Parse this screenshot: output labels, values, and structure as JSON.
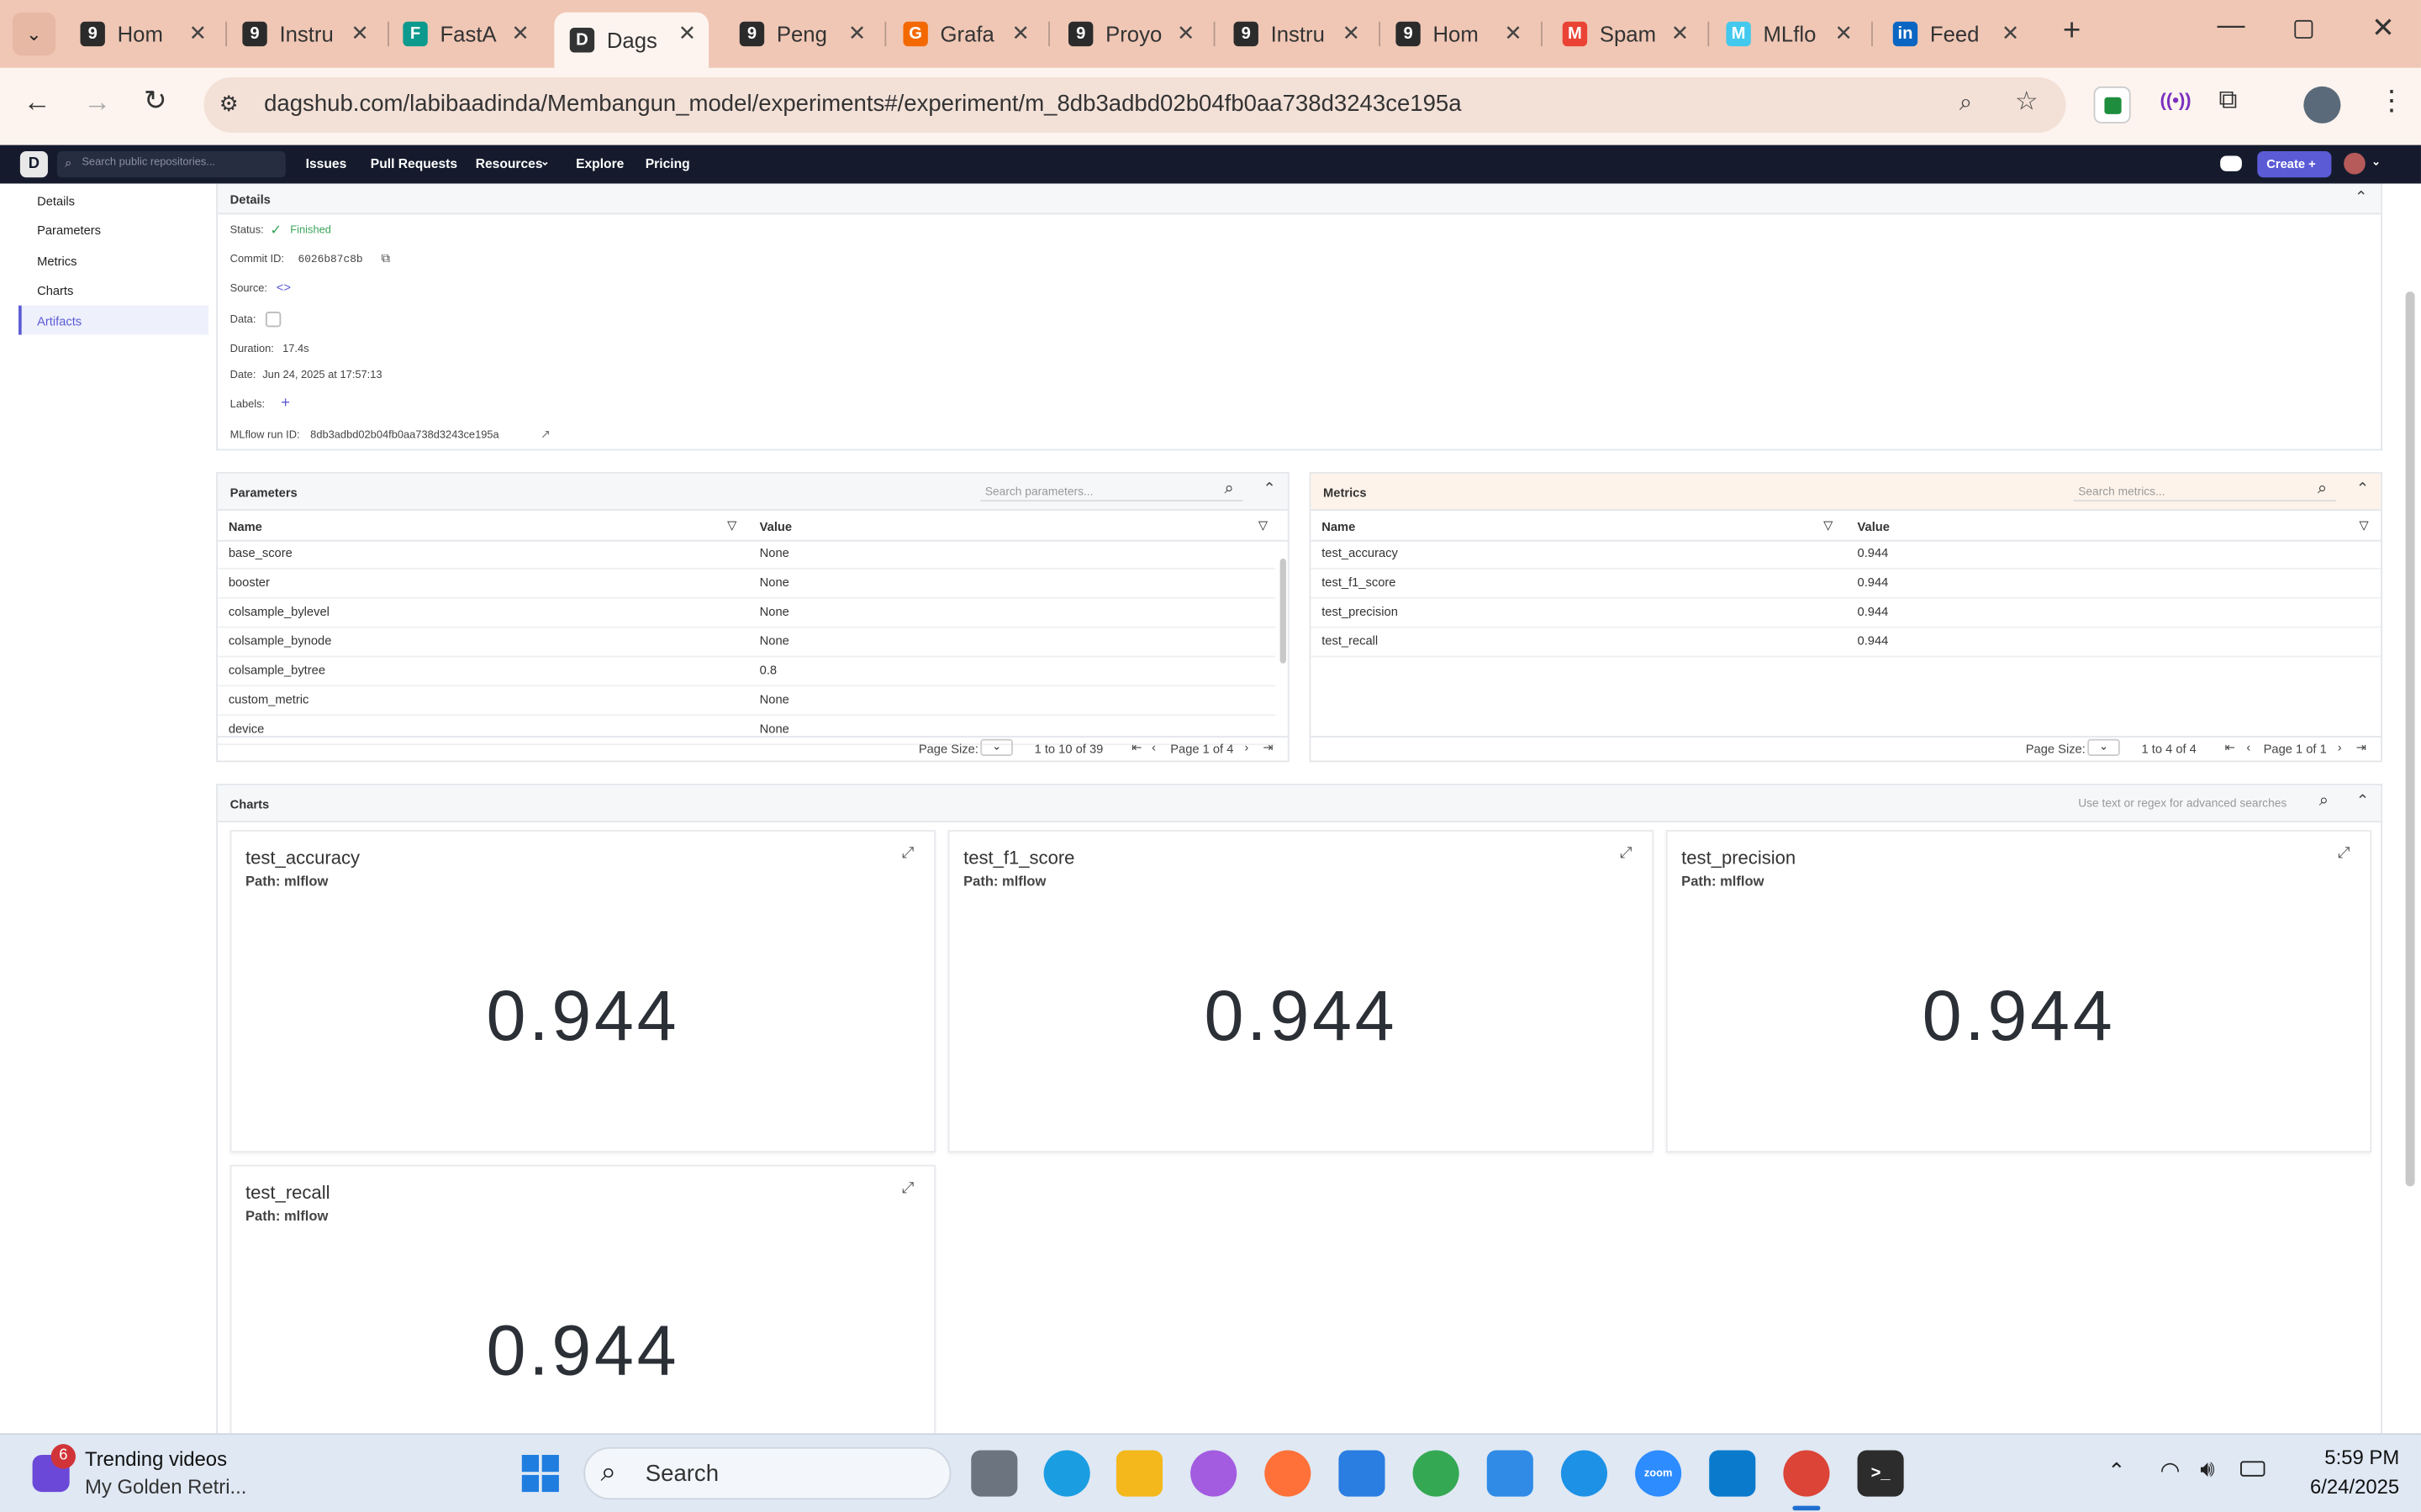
{
  "browser": {
    "tabs": [
      {
        "title": "Hom",
        "icon": "9",
        "color": "#2b2b2b"
      },
      {
        "title": "Instru",
        "icon": "9",
        "color": "#2b2b2b"
      },
      {
        "title": "FastA",
        "icon": "F",
        "color": "#0b9a8d"
      },
      {
        "title": "Dags",
        "icon": "D",
        "color": "#333333"
      },
      {
        "title": "Peng",
        "icon": "9",
        "color": "#2b2b2b"
      },
      {
        "title": "Grafa",
        "icon": "G",
        "color": "#f46800"
      },
      {
        "title": "Proyo",
        "icon": "9",
        "color": "#2b2b2b"
      },
      {
        "title": "Instru",
        "icon": "9",
        "color": "#2b2b2b"
      },
      {
        "title": "Hom",
        "icon": "9",
        "color": "#2b2b2b"
      },
      {
        "title": "Spam",
        "icon": "M",
        "color": "#ea4335"
      },
      {
        "title": "MLflo",
        "icon": "M",
        "color": "#43c9ed"
      },
      {
        "title": "Feed",
        "icon": "in",
        "color": "#0a66c2"
      }
    ],
    "url": "dagshub.com/labibaadinda/Membangun_model/experiments#/experiment/m_8db3adbd02b04fb0aa738d3243ce195a"
  },
  "header": {
    "search_placeholder": "Search public repositories...",
    "nav": [
      "Issues",
      "Pull Requests",
      "Resources",
      "Explore",
      "Pricing"
    ],
    "create_label": "Create"
  },
  "sidebar": {
    "items": [
      "Details",
      "Parameters",
      "Metrics",
      "Charts",
      "Artifacts"
    ],
    "active": "Artifacts"
  },
  "details": {
    "title": "Details",
    "status_label": "Status:",
    "status_value": "Finished",
    "commit_label": "Commit ID:",
    "commit_value": "6026b87c8b",
    "source_label": "Source:",
    "data_label": "Data:",
    "duration_label": "Duration:",
    "duration_value": "17.4s",
    "date_label": "Date:",
    "date_value": "Jun 24, 2025 at 17:57:13",
    "labels_label": "Labels:",
    "runid_label": "MLflow run ID:",
    "runid_value": "8db3adbd02b04fb0aa738d3243ce195a"
  },
  "parameters": {
    "title": "Parameters",
    "search_placeholder": "Search parameters...",
    "col_name": "Name",
    "col_value": "Value",
    "rows": [
      {
        "name": "base_score",
        "value": "None"
      },
      {
        "name": "booster",
        "value": "None"
      },
      {
        "name": "colsample_bylevel",
        "value": "None"
      },
      {
        "name": "colsample_bynode",
        "value": "None"
      },
      {
        "name": "colsample_bytree",
        "value": "0.8"
      },
      {
        "name": "custom_metric",
        "value": "None"
      },
      {
        "name": "device",
        "value": "None"
      }
    ],
    "page_size_label": "Page Size:",
    "range": "1 to 10 of 39",
    "page": "Page 1 of 4"
  },
  "metrics": {
    "title": "Metrics",
    "search_placeholder": "Search metrics...",
    "col_name": "Name",
    "col_value": "Value",
    "rows": [
      {
        "name": "test_accuracy",
        "value": "0.944"
      },
      {
        "name": "test_f1_score",
        "value": "0.944"
      },
      {
        "name": "test_precision",
        "value": "0.944"
      },
      {
        "name": "test_recall",
        "value": "0.944"
      }
    ],
    "page_size_label": "Page Size:",
    "range": "1 to 4 of 4",
    "page": "Page 1 of 1"
  },
  "charts": {
    "title": "Charts",
    "search_placeholder": "Use text or regex for advanced searches",
    "cards": [
      {
        "title": "test_accuracy",
        "path": "Path: mlflow",
        "value": "0.944"
      },
      {
        "title": "test_f1_score",
        "path": "Path: mlflow",
        "value": "0.944"
      },
      {
        "title": "test_precision",
        "path": "Path: mlflow",
        "value": "0.944"
      },
      {
        "title": "test_recall",
        "path": "Path: mlflow",
        "value": "0.944"
      }
    ]
  },
  "taskbar": {
    "widget_badge": "6",
    "widget_title": "Trending videos",
    "widget_sub": "My Golden Retri...",
    "search_label": "Search",
    "time": "5:59 PM",
    "date": "6/24/2025"
  }
}
